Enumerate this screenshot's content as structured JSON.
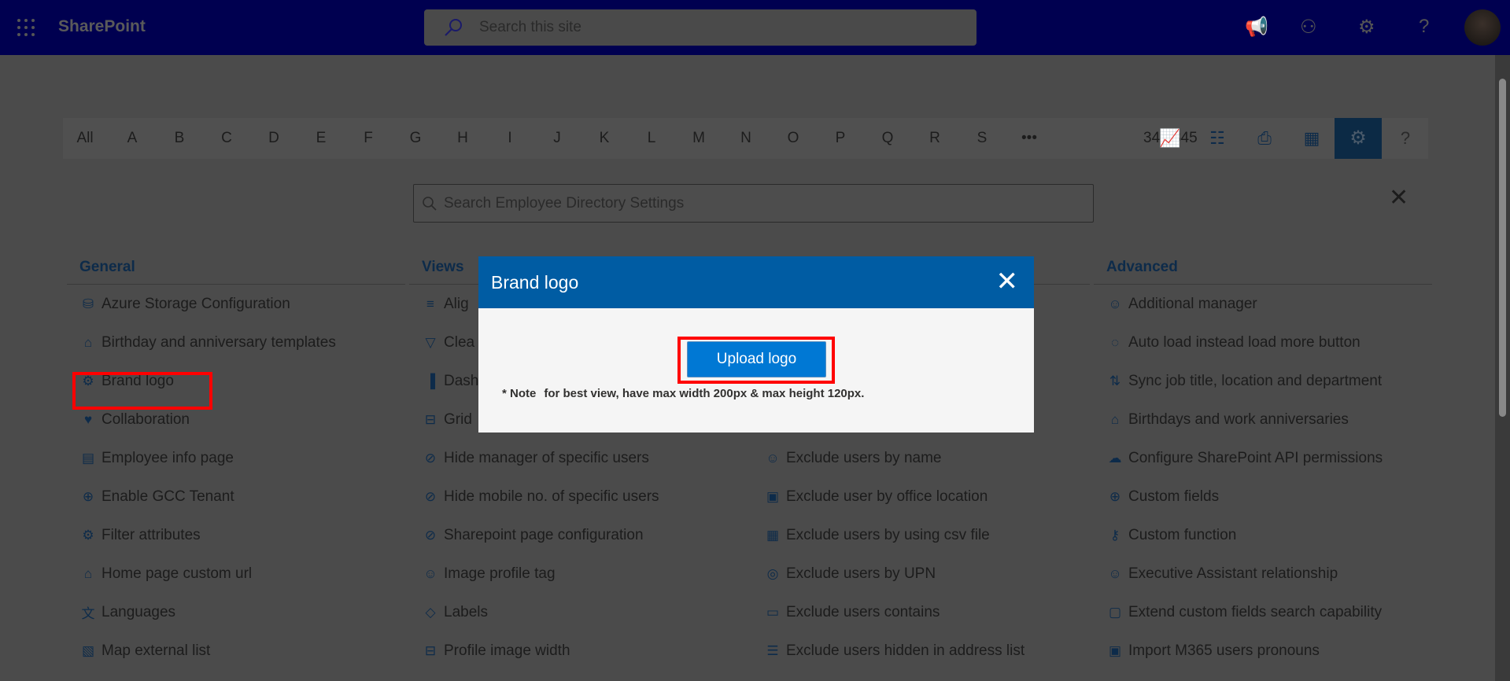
{
  "topbar": {
    "app_name": "SharePoint",
    "search_placeholder": "Search this site",
    "icons": [
      "waffle-icon",
      "megaphone-icon",
      "chat-icon",
      "settings-icon",
      "help-icon",
      "avatar"
    ]
  },
  "alphabet": {
    "letters": [
      "All",
      "A",
      "B",
      "C",
      "D",
      "E",
      "F",
      "G",
      "H",
      "I",
      "J",
      "K",
      "L",
      "M",
      "N",
      "O",
      "P",
      "Q",
      "R",
      "S",
      "•••"
    ],
    "count": "345/345",
    "tools": [
      "analytics-icon",
      "org-chart-icon",
      "print-icon",
      "excel-export-icon",
      "settings-icon",
      "help-icon"
    ],
    "active_tool": "settings-icon"
  },
  "settings_search": {
    "placeholder": "Search Employee Directory Settings"
  },
  "columns": [
    {
      "title": "General",
      "items": [
        {
          "icon": "database-icon",
          "glyph": "⛁",
          "label": "Azure Storage Configuration"
        },
        {
          "icon": "cake-icon",
          "glyph": "⌂",
          "label": "Birthday and anniversary templates"
        },
        {
          "icon": "badge-check-icon",
          "glyph": "⚙",
          "label": "Brand logo"
        },
        {
          "icon": "handshake-icon",
          "glyph": "♥",
          "label": "Collaboration"
        },
        {
          "icon": "person-page-icon",
          "glyph": "▤",
          "label": "Employee info page"
        },
        {
          "icon": "globe-icon",
          "glyph": "⊕",
          "label": "Enable GCC Tenant"
        },
        {
          "icon": "badge-check-icon",
          "glyph": "⚙",
          "label": "Filter attributes"
        },
        {
          "icon": "home-icon",
          "glyph": "⌂",
          "label": "Home page custom url"
        },
        {
          "icon": "translate-icon",
          "glyph": "文",
          "label": "Languages"
        },
        {
          "icon": "map-icon",
          "glyph": "▧",
          "label": "Map external list"
        }
      ]
    },
    {
      "title": "Views",
      "items": [
        {
          "icon": "align-icon",
          "glyph": "≡",
          "label": "Alig"
        },
        {
          "icon": "filter-icon",
          "glyph": "▽",
          "label": "Clea"
        },
        {
          "icon": "analytics-icon",
          "glyph": "▐",
          "label": "Dash"
        },
        {
          "icon": "grid-icon",
          "glyph": "⊟",
          "label": "Grid"
        },
        {
          "icon": "hide-icon",
          "glyph": "⊘",
          "label": "Hide manager of specific users"
        },
        {
          "icon": "hide-icon",
          "glyph": "⊘",
          "label": "Hide mobile no. of specific users"
        },
        {
          "icon": "hide-icon",
          "glyph": "⊘",
          "label": "Sharepoint page configuration"
        },
        {
          "icon": "person-icon",
          "glyph": "☺",
          "label": "Image profile tag"
        },
        {
          "icon": "tag-icon",
          "glyph": "◇",
          "label": "Labels"
        },
        {
          "icon": "grid-icon",
          "glyph": "⊟",
          "label": "Profile image width"
        }
      ]
    },
    {
      "title": "",
      "items": [
        {
          "icon": "",
          "glyph": "",
          "label": ""
        },
        {
          "icon": "",
          "glyph": "",
          "label": ""
        },
        {
          "icon": "",
          "glyph": "",
          "label": ""
        },
        {
          "icon": "",
          "glyph": "",
          "label": ""
        },
        {
          "icon": "person-info-icon",
          "glyph": "☺",
          "label": "Exclude users by name"
        },
        {
          "icon": "office-icon",
          "glyph": "▣",
          "label": "Exclude user by office location"
        },
        {
          "icon": "excel-icon",
          "glyph": "▦",
          "label": "Exclude users by using csv file"
        },
        {
          "icon": "broadcast-icon",
          "glyph": "◎",
          "label": "Exclude users by UPN"
        },
        {
          "icon": "folder-person-icon",
          "glyph": "▭",
          "label": "Exclude users contains"
        },
        {
          "icon": "list-icon",
          "glyph": "☰",
          "label": "Exclude users hidden in address list"
        }
      ]
    },
    {
      "title": "Advanced",
      "items": [
        {
          "icon": "manager-icon",
          "glyph": "☺",
          "label": "Additional manager"
        },
        {
          "icon": "loading-icon",
          "glyph": "◌",
          "label": "Auto load instead load more button"
        },
        {
          "icon": "sync-icon",
          "glyph": "⇅",
          "label": "Sync job title, location and department"
        },
        {
          "icon": "cake-icon",
          "glyph": "⌂",
          "label": "Birthdays and work anniversaries"
        },
        {
          "icon": "cloud-sync-icon",
          "glyph": "☁",
          "label": "Configure SharePoint API permissions"
        },
        {
          "icon": "add-circle-icon",
          "glyph": "⊕",
          "label": "Custom fields"
        },
        {
          "icon": "key-icon",
          "glyph": "⚷",
          "label": "Custom function"
        },
        {
          "icon": "people-icon",
          "glyph": "☺",
          "label": "Executive Assistant relationship"
        },
        {
          "icon": "search-doc-icon",
          "glyph": "▢",
          "label": "Extend custom fields search capability"
        },
        {
          "icon": "contact-card-icon",
          "glyph": "▣",
          "label": "Import M365 users pronouns"
        }
      ]
    }
  ],
  "modal": {
    "title": "Brand logo",
    "upload_label": "Upload logo",
    "note_label": "* Note",
    "note_text": "for best view, have max width 200px & max height 120px."
  },
  "colors": {
    "topbar": "#0000a8",
    "accent": "#0078d4",
    "modal_header": "#005ca3",
    "highlight": "#ff0000"
  }
}
